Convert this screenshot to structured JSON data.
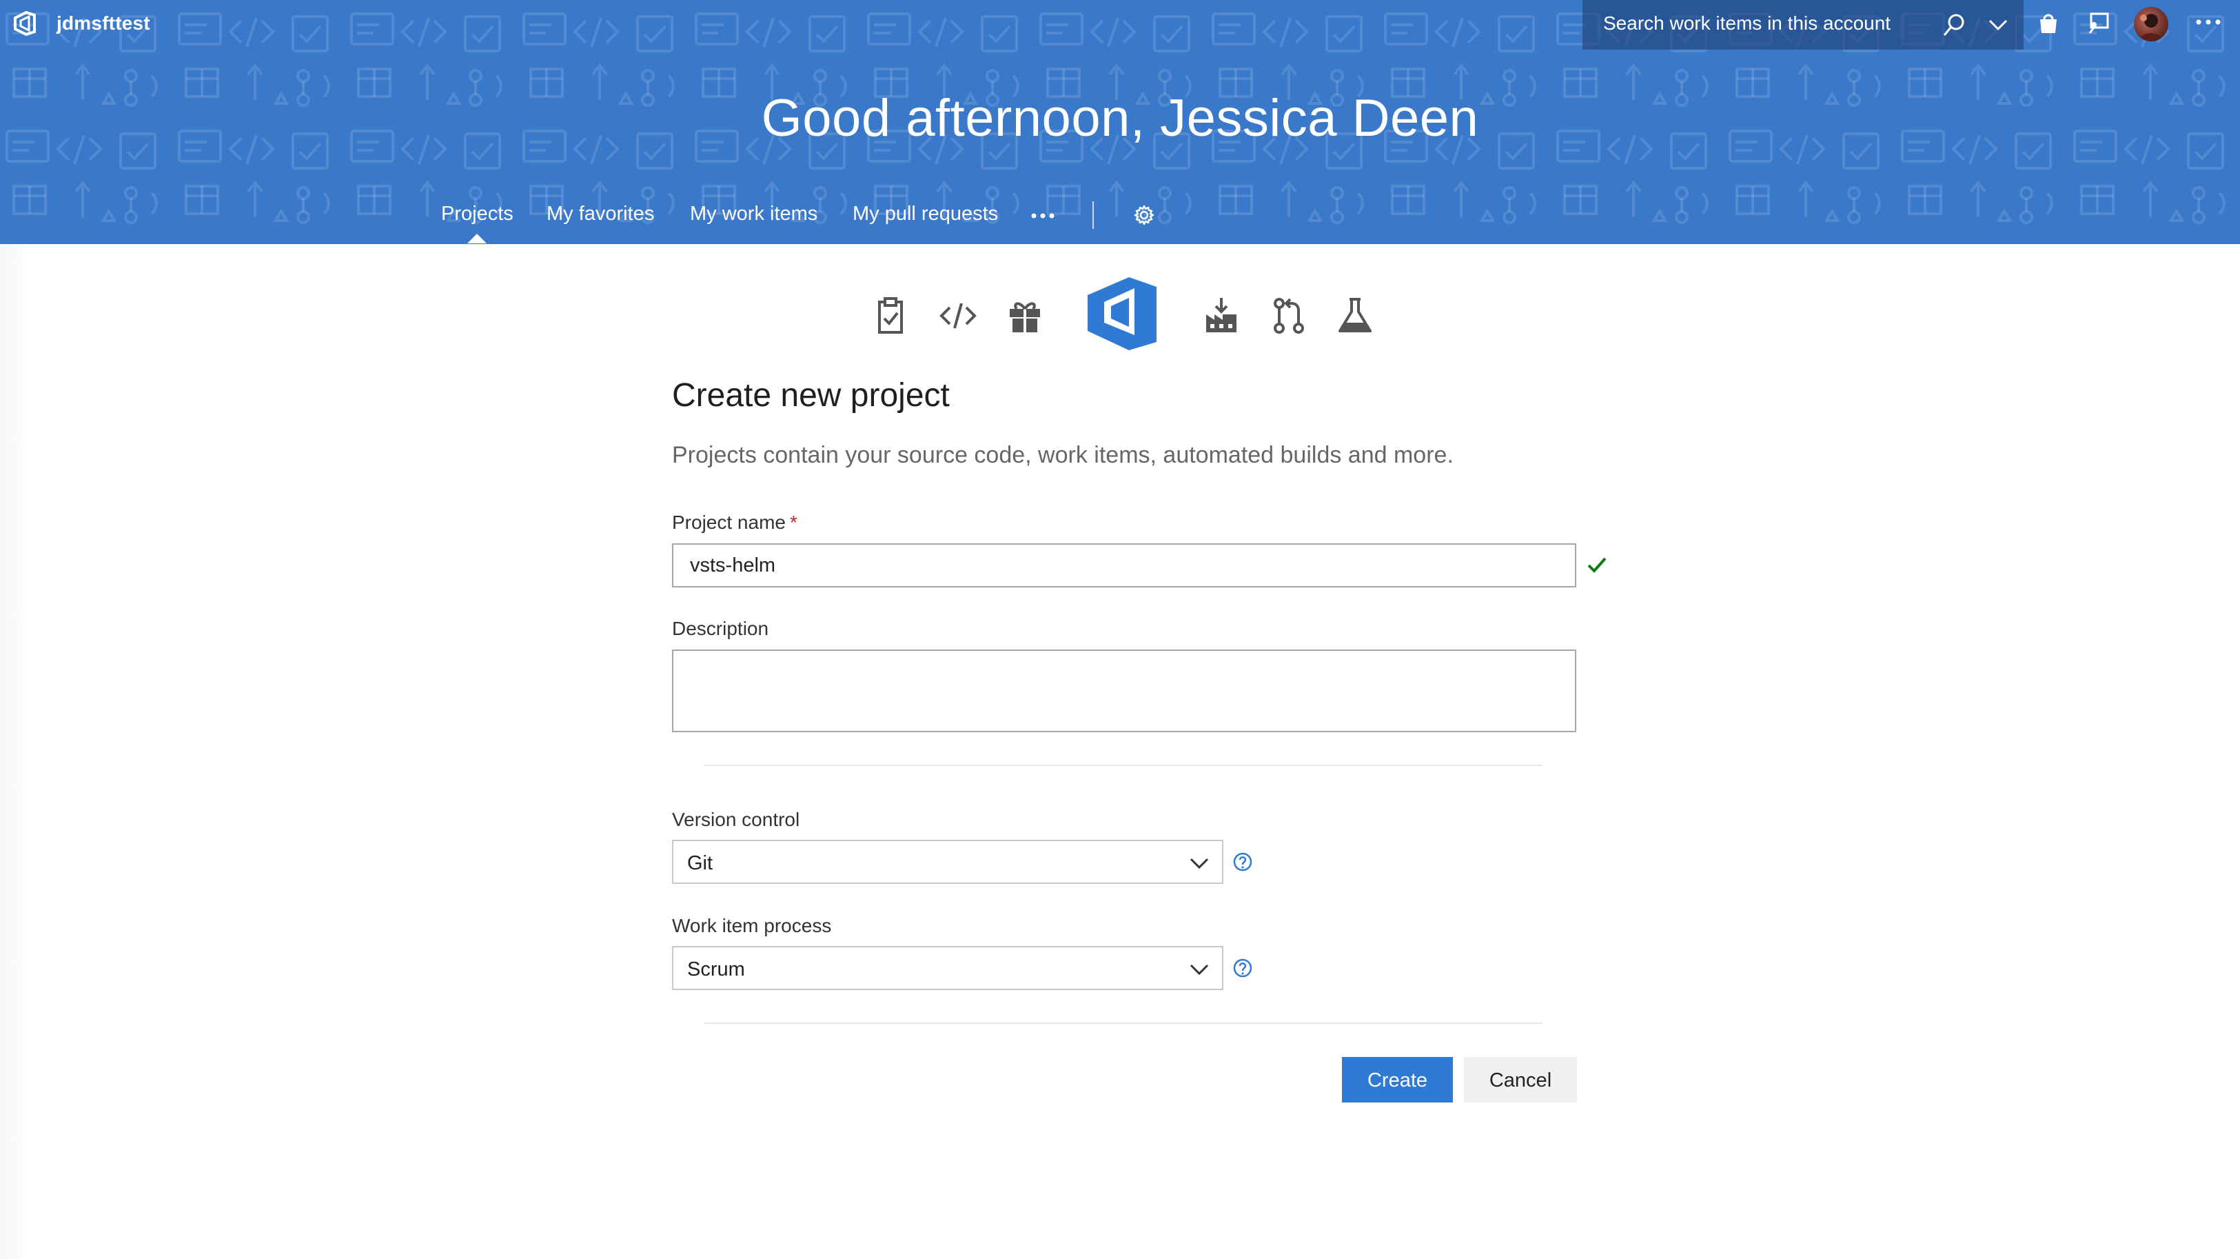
{
  "header": {
    "account_name": "jdmsfttest",
    "search_placeholder": "Search work items in this account",
    "greeting": "Good afternoon, Jessica Deen",
    "icons": [
      "vsts-logo-icon",
      "search-icon",
      "chevron-down-icon",
      "marketplace-bag-icon",
      "feedback-icon",
      "avatar",
      "more-icon"
    ],
    "brand_color": "#3a78c9"
  },
  "nav": {
    "items": [
      {
        "label": "Projects",
        "active": true
      },
      {
        "label": "My favorites",
        "active": false
      },
      {
        "label": "My work items",
        "active": false
      },
      {
        "label": "My pull requests",
        "active": false
      }
    ],
    "more_icon": "more-icon",
    "settings_icon": "gear-icon"
  },
  "services": {
    "icons": [
      "work-clipboard-icon",
      "code-icon",
      "release-gift-icon",
      "vsts-big-logo",
      "build-factory-icon",
      "pull-request-icon",
      "test-flask-icon"
    ]
  },
  "form": {
    "title": "Create new project",
    "subtitle": "Projects contain your source code, work items, automated builds and more.",
    "project_name_label": "Project name",
    "required_mark": "*",
    "project_name_value": "vsts-helm",
    "description_label": "Description",
    "description_value": "",
    "version_control_label": "Version control",
    "version_control_value": "Git",
    "work_item_process_label": "Work item process",
    "work_item_process_value": "Scrum",
    "valid_color": "#107c10",
    "help_color": "#2f7ad3"
  },
  "actions": {
    "create_label": "Create",
    "cancel_label": "Cancel",
    "primary_color": "#2f7ad3"
  }
}
